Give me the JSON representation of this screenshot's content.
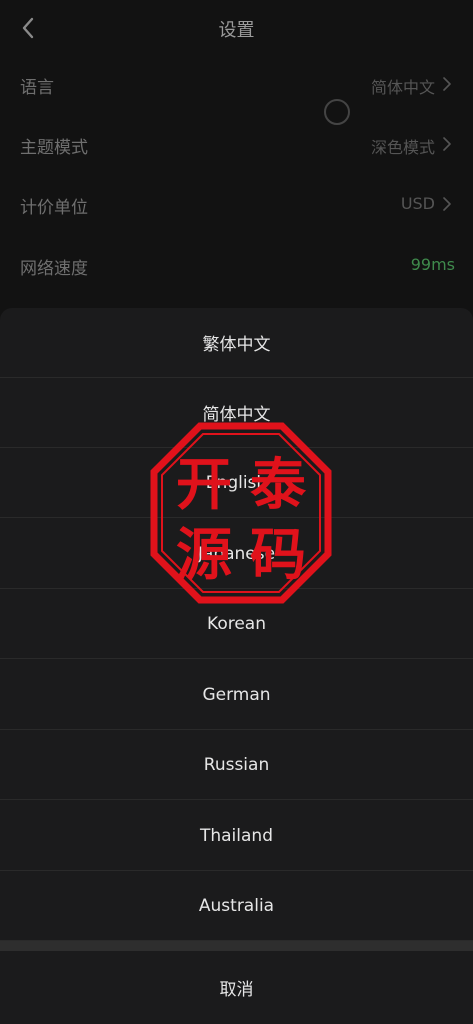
{
  "header": {
    "title": "设置",
    "back_icon": "chevron-left-icon"
  },
  "settings": [
    {
      "label": "语言",
      "value": "简体中文",
      "chevron": true
    },
    {
      "label": "主题模式",
      "value": "深色模式",
      "chevron": true
    },
    {
      "label": "计价单位",
      "value": "USD",
      "chevron": true
    },
    {
      "label": "网络速度",
      "value": "99ms",
      "chevron": false
    }
  ],
  "language_sheet": {
    "options": [
      "繁体中文",
      "简体中文",
      "English",
      "Japanese",
      "Korean",
      "German",
      "Russian",
      "Thailand",
      "Australia"
    ],
    "cancel_label": "取消"
  },
  "watermark": {
    "text": "开泰源码",
    "color": "#e0121b"
  },
  "colors": {
    "background": "#121212",
    "sheet": "#1b1b1c",
    "accent_green": "#3f8a4c",
    "text_primary": "#e6e6e6"
  }
}
